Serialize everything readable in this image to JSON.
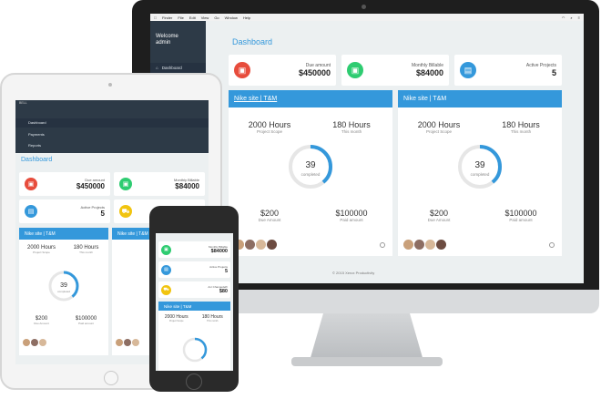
{
  "menubar": {
    "items": [
      "Finder",
      "File",
      "Edit",
      "View",
      "Go",
      "Window",
      "Help"
    ]
  },
  "sidebar": {
    "welcome": "Welcome",
    "user": "admin",
    "items": [
      {
        "label": "Dashboard"
      },
      {
        "label": "Payments"
      },
      {
        "label": "Reports"
      }
    ]
  },
  "page": {
    "title": "Dashboard"
  },
  "stats": {
    "due": {
      "label": "Due amount",
      "value": "$450000"
    },
    "billable": {
      "label": "Monthly Billable",
      "value": "$84000"
    },
    "projects": {
      "label": "Active Projects",
      "value": "5"
    },
    "changeorder": {
      "label": "Avr Changedelfr",
      "value": "$80"
    }
  },
  "project": {
    "title": "Nike site | T&M",
    "hours": "2000 Hours",
    "hours_label": "Project Scope",
    "month_hours": "180 Hours",
    "month_label": "This month",
    "percent": "39",
    "percent_unit": "%",
    "percent_fraction": 0.39,
    "percent_label": "completed",
    "due": "$200",
    "due_label": "Due Amount",
    "paid": "$100000",
    "paid_label": "Paid amount"
  },
  "ipad": {
    "status": "BELL",
    "sidebar": [
      "Dashboard",
      "Payments",
      "Reports"
    ]
  },
  "footer": "© 2015 Xerox Productivity",
  "colors": {
    "red": "#e74c3c",
    "green": "#2ecc71",
    "blue": "#3498db",
    "yellow": "#f1c40f",
    "sidebar": "#2d3a47"
  },
  "icons": {
    "due": "money-icon",
    "billable": "money-icon",
    "projects": "briefcase-icon",
    "changeorder": "cart-icon"
  }
}
